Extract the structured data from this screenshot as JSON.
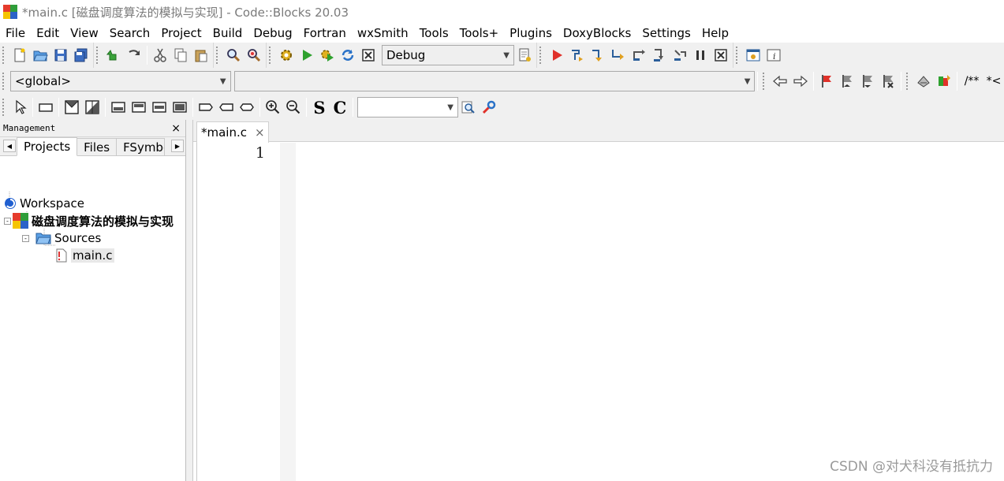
{
  "window": {
    "title": "*main.c [磁盘调度算法的模拟与实现] - Code::Blocks 20.03"
  },
  "menu": [
    "File",
    "Edit",
    "View",
    "Search",
    "Project",
    "Build",
    "Debug",
    "Fortran",
    "wxSmith",
    "Tools",
    "Tools+",
    "Plugins",
    "DoxyBlocks",
    "Settings",
    "Help"
  ],
  "toolbar": {
    "build_target": "Debug",
    "scope_combo": "<global>",
    "symbol_combo": "",
    "doxy_comment_1": "/**",
    "doxy_comment_2": "*<",
    "bold_s": "S",
    "bold_c": "C",
    "search_combo": ""
  },
  "management": {
    "title": "Management",
    "close": "×",
    "tabs": [
      "Projects",
      "Files",
      "FSymbols"
    ],
    "tree": {
      "workspace": "Workspace",
      "project": "磁盘调度算法的模拟与实现",
      "folder": "Sources",
      "file": "main.c"
    }
  },
  "editor": {
    "tab_label": "*main.c",
    "tab_close": "×",
    "line_numbers": [
      "1"
    ]
  },
  "watermark": "CSDN @对犬科没有抵抗力",
  "colors": {
    "change_marker": "#f5d200",
    "toolbar_bg": "#f0f0f0"
  }
}
